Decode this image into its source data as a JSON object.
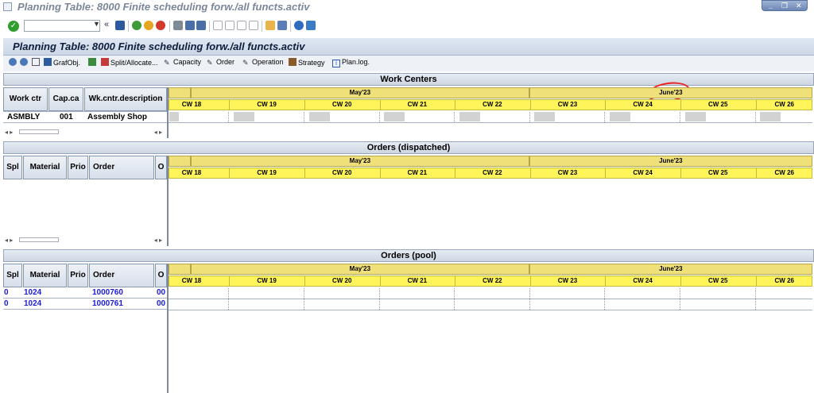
{
  "window": {
    "title": "Planning Table: 8000 Finite scheduling forw./all functs.activ"
  },
  "header": {
    "title": "Planning Table: 8000 Finite scheduling forw./all functs.activ"
  },
  "app_toolbar": {
    "graf_obj": "GrafObj.",
    "split_allocate": "Split/Allocate...",
    "capacity": "Capacity",
    "order": "Order",
    "operation": "Operation",
    "strategy": "Strategy",
    "plan_log": "Plan.log."
  },
  "timeline": {
    "months": [
      "May'23",
      "June'23"
    ],
    "weeks": [
      "CW 18",
      "CW 19",
      "CW 20",
      "CW 21",
      "CW 22",
      "CW 23",
      "CW 24",
      "CW 25",
      "CW 26"
    ]
  },
  "work_centers": {
    "title": "Work Centers",
    "columns": [
      "Work ctr",
      "Cap.ca",
      "Wk.cntr.description"
    ],
    "rows": [
      {
        "work_ctr": "ASMBLY",
        "cap": "001",
        "desc": "Assembly Shop"
      }
    ]
  },
  "orders_dispatched": {
    "title": "Orders (dispatched)",
    "columns": [
      "Spl",
      "Material",
      "Prio",
      "Order",
      "O"
    ]
  },
  "orders_pool": {
    "title": "Orders (pool)",
    "columns": [
      "Spl",
      "Material",
      "Prio",
      "Order",
      "O"
    ],
    "rows": [
      {
        "spl": "0",
        "material": "1024",
        "prio": "",
        "order": "1000760",
        "op": "00"
      },
      {
        "spl": "0",
        "material": "1024",
        "prio": "",
        "order": "1000761",
        "op": "00"
      }
    ]
  },
  "colors": {
    "month_band": "#f0e07a",
    "week_band": "#fff45a",
    "highlight_circle": "#e22222",
    "pool_text": "#1a1ad8"
  }
}
